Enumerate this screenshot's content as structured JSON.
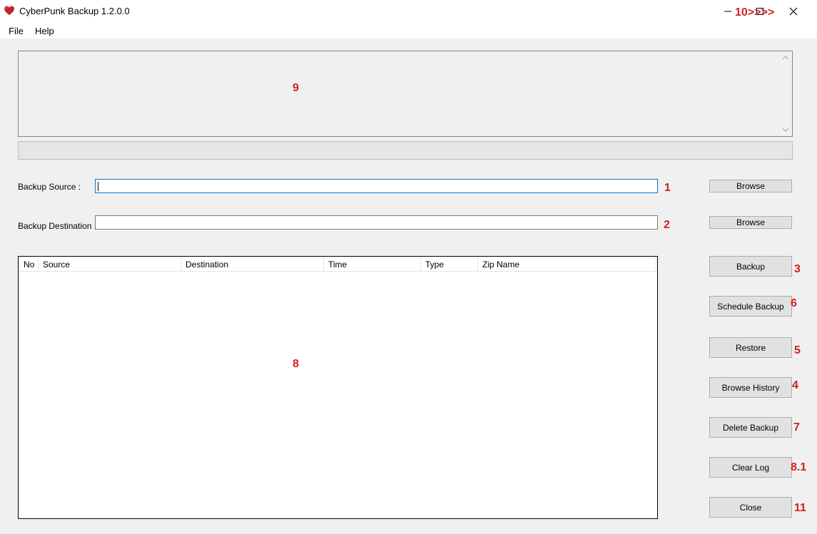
{
  "window": {
    "title": "CyberPunk Backup 1.2.0.0",
    "app_icon": "heart-icon",
    "minimize_icon": "minimize-icon",
    "maximize_icon": "maximize-icon",
    "close_icon": "close-icon"
  },
  "menu": {
    "items": [
      {
        "label": "File"
      },
      {
        "label": "Help"
      }
    ]
  },
  "log": {
    "text": ""
  },
  "form": {
    "source_label": "Backup Source :",
    "source_value": "",
    "destination_label": "Backup Destination :",
    "destination_value": "",
    "browse_label": "Browse"
  },
  "table": {
    "columns": [
      "No",
      "Source",
      "Destination",
      "Time",
      "Type",
      "Zip Name"
    ],
    "rows": []
  },
  "buttons": {
    "backup": "Backup",
    "schedule_backup": "Schedule Backup",
    "restore": "Restore",
    "browse_history": "Browse History",
    "delete_backup": "Delete Backup",
    "clear_log": "Clear Log",
    "close": "Close"
  },
  "annotations": {
    "a1": "1",
    "a2": "2",
    "a3": "3",
    "a4": "4",
    "a5": "5",
    "a6": "6",
    "a7": "7",
    "a8": "8",
    "a8_1": "8.1",
    "a9": "9",
    "a10": "10>>>>",
    "a11": "11",
    "color": "#d11f1f"
  },
  "colors": {
    "window_bg": "#f0f0f0",
    "titlebar_bg": "#ffffff",
    "button_bg": "#e1e1e1",
    "focus_border": "#0078d7",
    "icon_red": "#c0272d"
  }
}
